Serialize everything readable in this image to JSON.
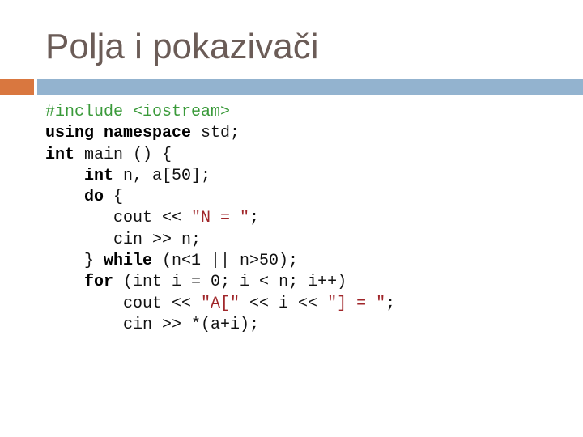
{
  "slide": {
    "title": "Polja i pokazivači"
  },
  "colors": {
    "title": "#6b5c57",
    "accent_bar": "#d9773f",
    "main_bar": "#93b3cf",
    "preprocessor": "#3a9a3a",
    "string": "#a0262a",
    "keyword": "#000000"
  },
  "code": {
    "lines": [
      [
        {
          "t": "#include <iostream>",
          "c": "pp"
        }
      ],
      [
        {
          "t": "using namespace",
          "c": "kw"
        },
        {
          "t": " std;",
          "c": ""
        }
      ],
      [
        {
          "t": "int",
          "c": "kw"
        },
        {
          "t": " main () {",
          "c": ""
        }
      ],
      [
        {
          "t": "    ",
          "c": ""
        },
        {
          "t": "int",
          "c": "kw"
        },
        {
          "t": " n, a[50];",
          "c": ""
        }
      ],
      [
        {
          "t": "    ",
          "c": ""
        },
        {
          "t": "do",
          "c": "kw"
        },
        {
          "t": " {",
          "c": ""
        }
      ],
      [
        {
          "t": "       cout << ",
          "c": ""
        },
        {
          "t": "\"N = \"",
          "c": "str"
        },
        {
          "t": ";",
          "c": ""
        }
      ],
      [
        {
          "t": "       cin >> n;",
          "c": ""
        }
      ],
      [
        {
          "t": "    } ",
          "c": ""
        },
        {
          "t": "while",
          "c": "kw"
        },
        {
          "t": " (n<1 || n>50);",
          "c": ""
        }
      ],
      [
        {
          "t": "    ",
          "c": ""
        },
        {
          "t": "for",
          "c": "kw"
        },
        {
          "t": " (int i = 0; i < n; i++)",
          "c": ""
        }
      ],
      [
        {
          "t": "        cout << ",
          "c": ""
        },
        {
          "t": "\"A[\"",
          "c": "str"
        },
        {
          "t": " << i << ",
          "c": ""
        },
        {
          "t": "\"] = \"",
          "c": "str"
        },
        {
          "t": ";",
          "c": ""
        }
      ],
      [
        {
          "t": "        cin >> *(a+i);",
          "c": ""
        }
      ]
    ]
  }
}
